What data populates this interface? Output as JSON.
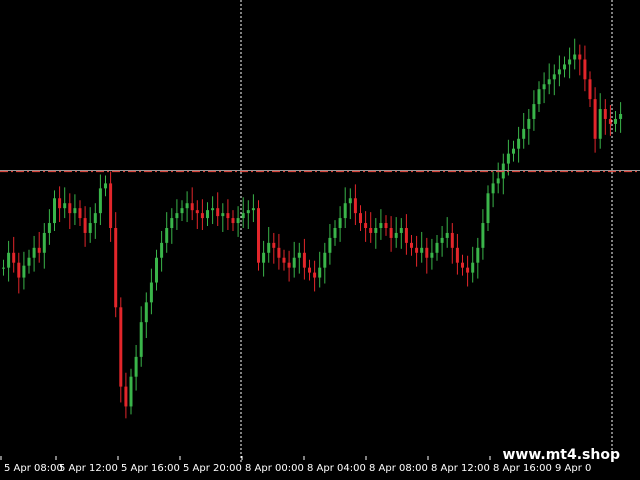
{
  "chart_data": {
    "type": "candlestick",
    "colors": {
      "background": "#000000",
      "bull": "#3ab54a",
      "bear": "#e3262b",
      "text": "#ffffff",
      "separator": "#ffffff",
      "level_line_red": "#d9473e",
      "level_line_gray": "#9a9a9a"
    },
    "x_ticks": [
      "5 Apr 08:00",
      "5 Apr 12:00",
      "5 Apr 16:00",
      "5 Apr 20:00",
      "8 Apr 00:00",
      "8 Apr 04:00",
      "8 Apr 08:00",
      "8 Apr 12:00",
      "8 Apr 16:00",
      "9 Apr 0"
    ],
    "day_separators": [
      "8 Apr 00:00",
      "9 Apr 0"
    ],
    "horizontal_level": 2.87,
    "ylim": [
      0,
      4.6
    ],
    "ohlc_close_path": [
      1.9,
      2.05,
      1.95,
      1.8,
      1.92,
      2.0,
      2.1,
      2.05,
      2.25,
      2.35,
      2.6,
      2.5,
      2.55,
      2.45,
      2.5,
      2.4,
      2.25,
      2.35,
      2.45,
      2.7,
      2.75,
      2.3,
      1.5,
      0.7,
      0.5,
      0.8,
      1.0,
      1.35,
      1.55,
      1.75,
      2.0,
      2.15,
      2.3,
      2.4,
      2.45,
      2.5,
      2.55,
      2.48,
      2.45,
      2.4,
      2.48,
      2.5,
      2.42,
      2.45,
      2.4,
      2.35,
      2.4,
      2.45,
      2.48,
      2.5,
      1.95,
      2.05,
      2.15,
      2.1,
      2.0,
      1.95,
      1.9,
      2.0,
      2.05,
      1.9,
      1.85,
      1.8,
      1.9,
      2.05,
      2.2,
      2.3,
      2.4,
      2.55,
      2.6,
      2.45,
      2.35,
      2.3,
      2.25,
      2.3,
      2.35,
      2.3,
      2.2,
      2.25,
      2.3,
      2.15,
      2.1,
      2.05,
      2.1,
      2.0,
      2.05,
      2.15,
      2.2,
      2.25,
      2.1,
      1.95,
      1.9,
      1.85,
      1.95,
      2.1,
      2.35,
      2.65,
      2.75,
      2.8,
      2.95,
      3.05,
      3.1,
      3.2,
      3.3,
      3.4,
      3.55,
      3.7,
      3.75,
      3.8,
      3.85,
      3.9,
      3.95,
      4.0,
      4.05,
      4.0,
      3.8,
      3.6,
      3.2,
      3.5,
      3.4,
      3.35,
      3.4,
      3.45
    ]
  },
  "watermark": {
    "text": "www.mt4.shop"
  }
}
